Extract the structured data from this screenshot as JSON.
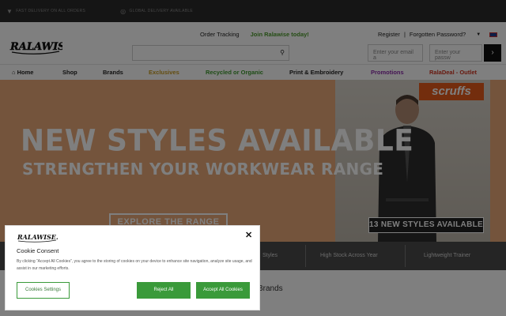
{
  "topbar": {
    "items": [
      {
        "icon": "truck-icon",
        "label": "FAST DELIVERY ON ALL ORDERS"
      },
      {
        "icon": "globe-icon",
        "label": "GLOBAL DELIVERY AVAILABLE"
      }
    ]
  },
  "header": {
    "logo_text": "RALAWISE",
    "order_tracking": "Order Tracking",
    "join": "Join Ralawise today!",
    "register": "Register",
    "separator": "|",
    "forgotten_password": "Forgotten Password?",
    "email_placeholder": "Enter your email a",
    "password_placeholder": "Enter your passw",
    "go_label": "›"
  },
  "nav": {
    "items": [
      {
        "label": "Home",
        "color": "#222222"
      },
      {
        "label": "Shop",
        "color": "#222222"
      },
      {
        "label": "Brands",
        "color": "#222222"
      },
      {
        "label": "Exclusives",
        "color": "#c79a1e"
      },
      {
        "label": "Recycled or Organic",
        "color": "#3e9a2e"
      },
      {
        "label": "Print & Embroidery",
        "color": "#222222"
      },
      {
        "label": "Promotions",
        "color": "#8a2aa8"
      },
      {
        "label": "RalaDeal - Outlet",
        "color": "#d0321e"
      }
    ]
  },
  "hero": {
    "headline": "NEW STYLES AVAILABLE",
    "subheadline": "STRENGTHEN YOUR WORKWEAR RANGE",
    "cta": "EXPLORE THE RANGE",
    "brand_badge": "scruffs",
    "tag": "13 NEW STYLES AVAILABLE",
    "bg_color": "#e8a978"
  },
  "features": {
    "items": [
      "Styles",
      "High Stock Across Year",
      "Lightweight Trainer"
    ]
  },
  "section": {
    "heading": "Brands"
  },
  "cookie": {
    "logo_text": "RALAWISE.com",
    "title": "Cookie Consent",
    "text": "By clicking “Accept All Cookies”, you agree to the storing of cookies on your device to enhance site navigation, analyze site usage, and assist in our marketing efforts.",
    "settings_label": "Cookies Settings",
    "reject_label": "Reject All",
    "accept_label": "Accept All Cookies",
    "close_label": "✕",
    "accent": "#3a9a3a"
  }
}
